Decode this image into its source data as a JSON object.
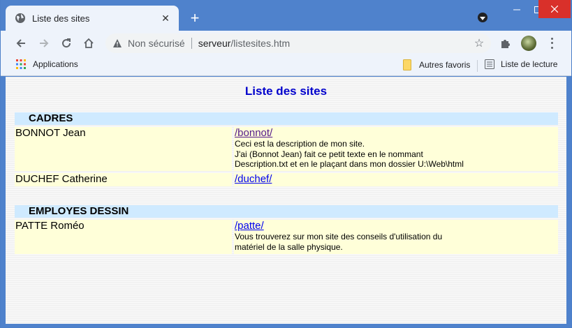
{
  "browser": {
    "tab_title": "Liste des sites",
    "new_tab_symbol": "+",
    "omnibox": {
      "security_label": "Non sécurisé",
      "host": "serveur",
      "path": "/listesites.htm"
    },
    "bookmarks": {
      "apps_label": "Applications",
      "other_favorites_label": "Autres favoris",
      "reading_list_label": "Liste de lecture"
    },
    "icons": [
      "globe-icon",
      "close-icon",
      "plus-icon",
      "tab-search-icon",
      "minimize-icon",
      "maximize-icon",
      "window-close-icon",
      "back-icon",
      "forward-icon",
      "reload-icon",
      "home-icon",
      "warning-icon",
      "star-icon",
      "puzzle-icon",
      "avatar",
      "kebab-menu-icon",
      "apps-grid-icon",
      "folder-icon",
      "reading-list-icon"
    ],
    "colors": {
      "frame": "#4f82cc",
      "close_button": "#d9302a"
    }
  },
  "page": {
    "title": "Liste des sites",
    "title_color": "#0000cc",
    "groups": [
      {
        "name": "CADRES",
        "rows": [
          {
            "person": "BONNOT Jean",
            "link": "/bonnot/",
            "visited": true,
            "description": [
              "Ceci est la description de mon site.",
              "J'ai (Bonnot Jean) fait ce petit texte en le nommant",
              "Description.txt et en le plaçant dans mon dossier U:\\Web\\html"
            ]
          },
          {
            "person": "DUCHEF Catherine",
            "link": "/duchef/",
            "visited": false,
            "description": []
          }
        ]
      },
      {
        "name": "EMPLOYES DESSIN",
        "rows": [
          {
            "person": "PATTE Roméo",
            "link": "/patte/",
            "visited": false,
            "description": [
              "Vous trouverez sur mon site des conseils d'utilisation du",
              "matériel de la salle physique."
            ]
          }
        ]
      }
    ],
    "colors": {
      "group_header": "#cfeaff",
      "row_background": "#ffffd9",
      "link": "#0000ee",
      "visited_link": "#551a8b"
    }
  }
}
